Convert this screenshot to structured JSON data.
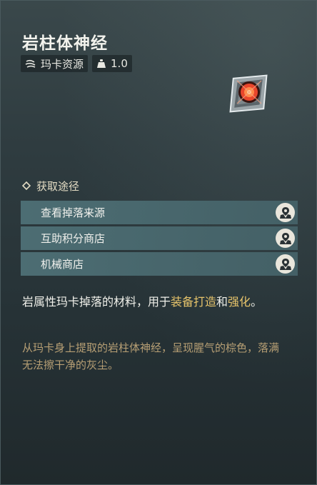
{
  "item": {
    "name": "岩柱体神经",
    "category": "玛卡资源",
    "weight": "1.0"
  },
  "acquisition": {
    "heading": "获取途径",
    "sources": [
      {
        "label": "查看掉落来源"
      },
      {
        "label": "互助积分商店"
      },
      {
        "label": "机械商店"
      }
    ]
  },
  "description": {
    "part1": "岩属性玛卡掉落的材料，用于",
    "highlight1": "装备打造",
    "part2": "和",
    "highlight2": "强化",
    "part3": "。"
  },
  "flavor_text": "从玛卡身上提取的岩柱体神经，呈现腥气的棕色，落满无法擦干净的灰尘。",
  "colors": {
    "highlight": "#e7c46b",
    "flavor": "#b79f74",
    "source_row": "#4e7076",
    "item_core": "#e8462c"
  },
  "icons": {
    "category": "claw-icon",
    "weight": "weight-icon",
    "section": "diamond-bullet-icon",
    "source_action": "map-pin-icon"
  }
}
